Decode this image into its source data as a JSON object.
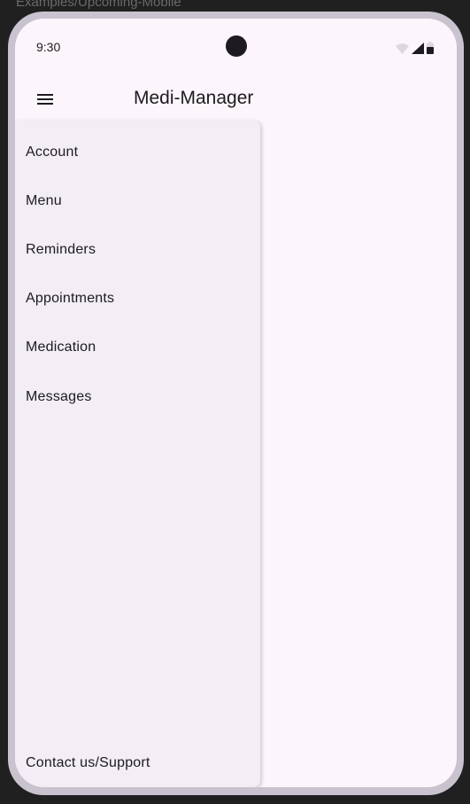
{
  "frame": {
    "caption": "Examples/Upcoming-Mobile"
  },
  "status_bar": {
    "time": "9:30",
    "icons": [
      "wifi-icon",
      "cellular-signal-icon",
      "battery-icon"
    ]
  },
  "app_bar": {
    "title": "Medi-Manager",
    "menu_icon": "hamburger-menu-icon"
  },
  "drawer": {
    "items": [
      {
        "label": "Account"
      },
      {
        "label": "Menu"
      },
      {
        "label": "Reminders"
      },
      {
        "label": "Appointments"
      },
      {
        "label": "Medication"
      },
      {
        "label": "Messages"
      }
    ],
    "footer_item": {
      "label": "Contact us/Support"
    }
  },
  "colors": {
    "background": "#fcf6fc",
    "drawer_background": "#f3edf6",
    "text": "#1d1b20",
    "device_frame": "#c9c3cf"
  }
}
